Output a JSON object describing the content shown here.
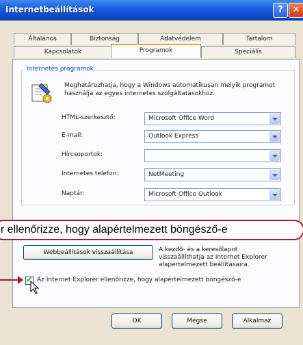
{
  "window": {
    "title": "Internetbeállítások",
    "help_glyph": "?",
    "close_glyph": "✕"
  },
  "tabs": {
    "row_back": [
      "Általános",
      "Biztonság",
      "Adatvédelem",
      "Tartalom"
    ],
    "row_front": [
      "Kapcsolatok",
      "Programok",
      "Speciális"
    ],
    "active": "Programok"
  },
  "group": {
    "title": "Internetes programok",
    "description": "Meghatározhatja, hogy a Windows automatikusan melyik programot használja az egyes internetes szolgáltatásokhoz."
  },
  "fields": [
    {
      "label": "HTML-szerkesztő:",
      "value": "Microsoft Office Word"
    },
    {
      "label": "E-mail:",
      "value": "Outlook Express"
    },
    {
      "label": "Hírcsoportok:",
      "value": ""
    },
    {
      "label": "Internetes telefon:",
      "value": "NetMeeting"
    },
    {
      "label": "Naptár:",
      "value": "Microsoft Office Outlook"
    }
  ],
  "callout": {
    "text": "er ellenőrizze, hogy alapértelmezett böngésző-e"
  },
  "reset": {
    "button_label": "Webbeállítások visszaállítása",
    "description": "A kezdő- és a keresőlapot visszaállíthatja az Internet Explorer alapértelmezett beállításaira."
  },
  "default_check": {
    "checked": true,
    "label": "Az Internet Explorer ellenőrizze, hogy alapértelmezett böngésző-e"
  },
  "footer": {
    "ok_label": "OK",
    "cancel_label": "Mégse",
    "apply_label": "Alkalmaz"
  },
  "colors": {
    "title_bar": "#0a48c8",
    "callout_border": "#b3123a",
    "group_title": "#0046d5"
  }
}
